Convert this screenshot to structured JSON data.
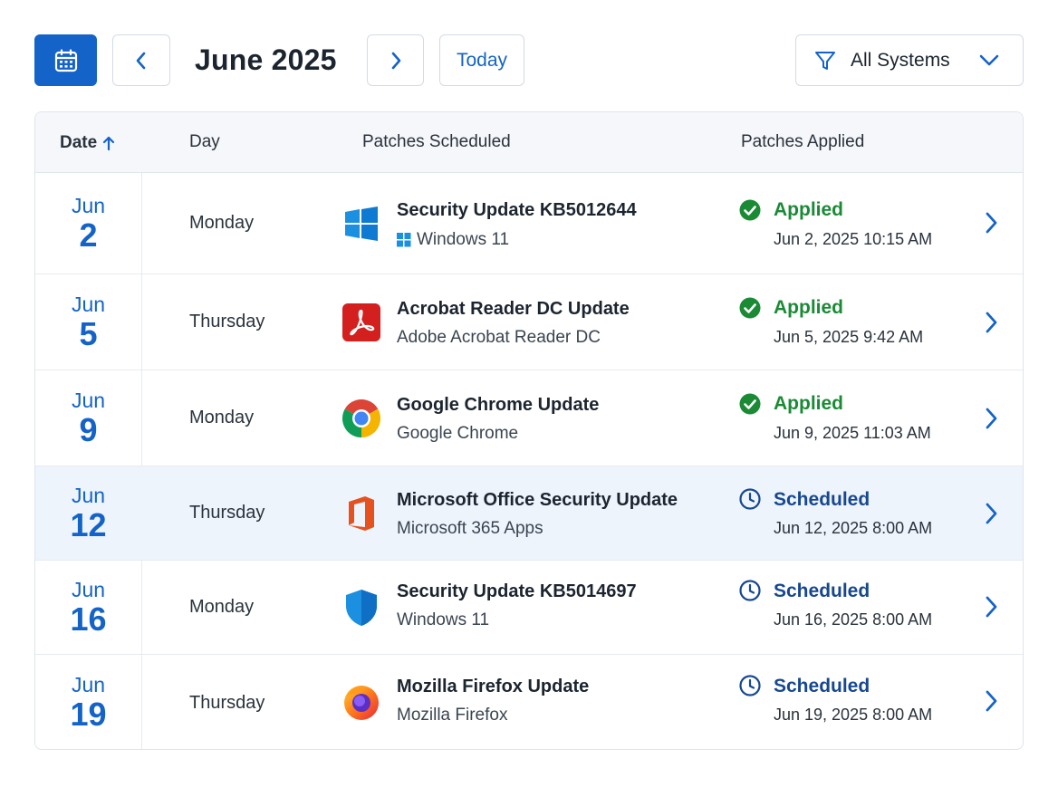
{
  "toolbar": {
    "month_title": "June 2025",
    "today_label": "Today",
    "filter_label": "All Systems",
    "accent_color": "#1463c9"
  },
  "table": {
    "headers": {
      "date": "Date",
      "day": "Day",
      "scheduled": "Patches Scheduled",
      "applied": "Patches Applied"
    },
    "sort": "date-ascending",
    "rows": [
      {
        "month": "Jun",
        "day_num": "2",
        "weekday": "Monday",
        "patch": "Security Update KB5012644",
        "product": "Windows 11",
        "icon": "windows-icon",
        "status": "Applied",
        "status_time": "Jun 2, 2025 10:15 AM"
      },
      {
        "month": "Jun",
        "day_num": "5",
        "weekday": "Thursday",
        "patch": "Acrobat Reader DC Update",
        "product": "Adobe Acrobat Reader DC",
        "icon": "acrobat-icon",
        "status": "Applied",
        "status_time": "Jun 5, 2025 9:42 AM"
      },
      {
        "month": "Jun",
        "day_num": "9",
        "weekday": "Monday",
        "patch": "Google Chrome Update",
        "product": "Google Chrome",
        "icon": "chrome-icon",
        "status": "Applied",
        "status_time": "Jun 9, 2025 11:03 AM"
      },
      {
        "month": "Jun",
        "day_num": "12",
        "weekday": "Thursday",
        "patch": "Microsoft Office Security Update",
        "product": "Microsoft 365 Apps",
        "icon": "office-icon",
        "status": "Scheduled",
        "status_time": "Jun 12, 2025 8:00 AM"
      },
      {
        "month": "Jun",
        "day_num": "16",
        "weekday": "Monday",
        "patch": "Security Update KB5014697",
        "product": "Windows 11",
        "icon": "defender-shield-icon",
        "status": "Scheduled",
        "status_time": "Jun 16, 2025 8:00 AM"
      },
      {
        "month": "Jun",
        "day_num": "19",
        "weekday": "Thursday",
        "patch": "Mozilla Firefox Update",
        "product": "Mozilla Firefox",
        "icon": "firefox-icon",
        "status": "Scheduled",
        "status_time": "Jun 19, 2025 8:00 AM"
      }
    ]
  },
  "colors": {
    "applied": "#1a8a35",
    "scheduled": "#17488f",
    "highlight_row": "#eef4fc"
  }
}
